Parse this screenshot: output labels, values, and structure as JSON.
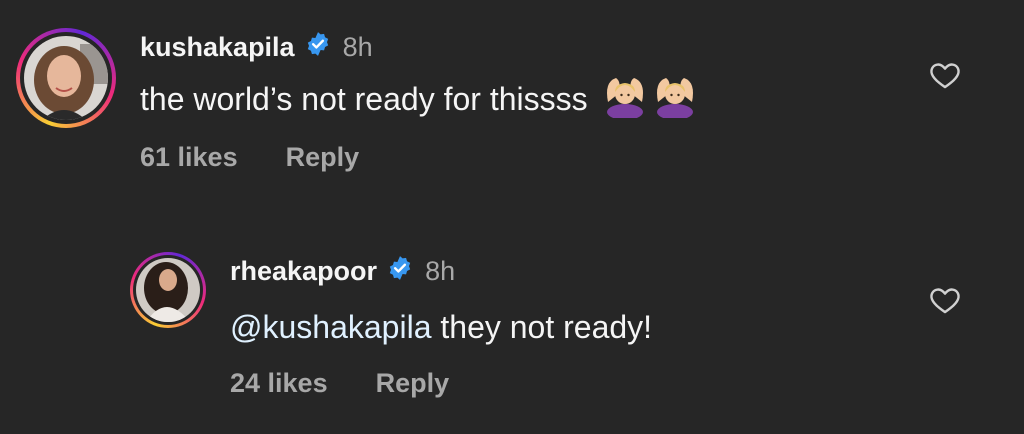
{
  "comments": [
    {
      "username": "kushakapila",
      "time": "8h",
      "text": "the world’s not ready for thissss",
      "emojis": [
        "raised-hands-woman-emoji",
        "raised-hands-woman-emoji"
      ],
      "likes": "61 likes",
      "reply_label": "Reply",
      "avatar_icon": "profile-photo"
    },
    {
      "username": "rheakapoor",
      "time": "8h",
      "mention": "@kushakapila",
      "text": " they not ready!",
      "likes": "24 likes",
      "reply_label": "Reply",
      "avatar_icon": "profile-photo"
    }
  ],
  "icons": {
    "verified": "verified-badge-icon",
    "like": "heart-outline-icon"
  },
  "colors": {
    "background": "#262626",
    "verified": "#3897f0",
    "muted": "#a8a8a8"
  }
}
